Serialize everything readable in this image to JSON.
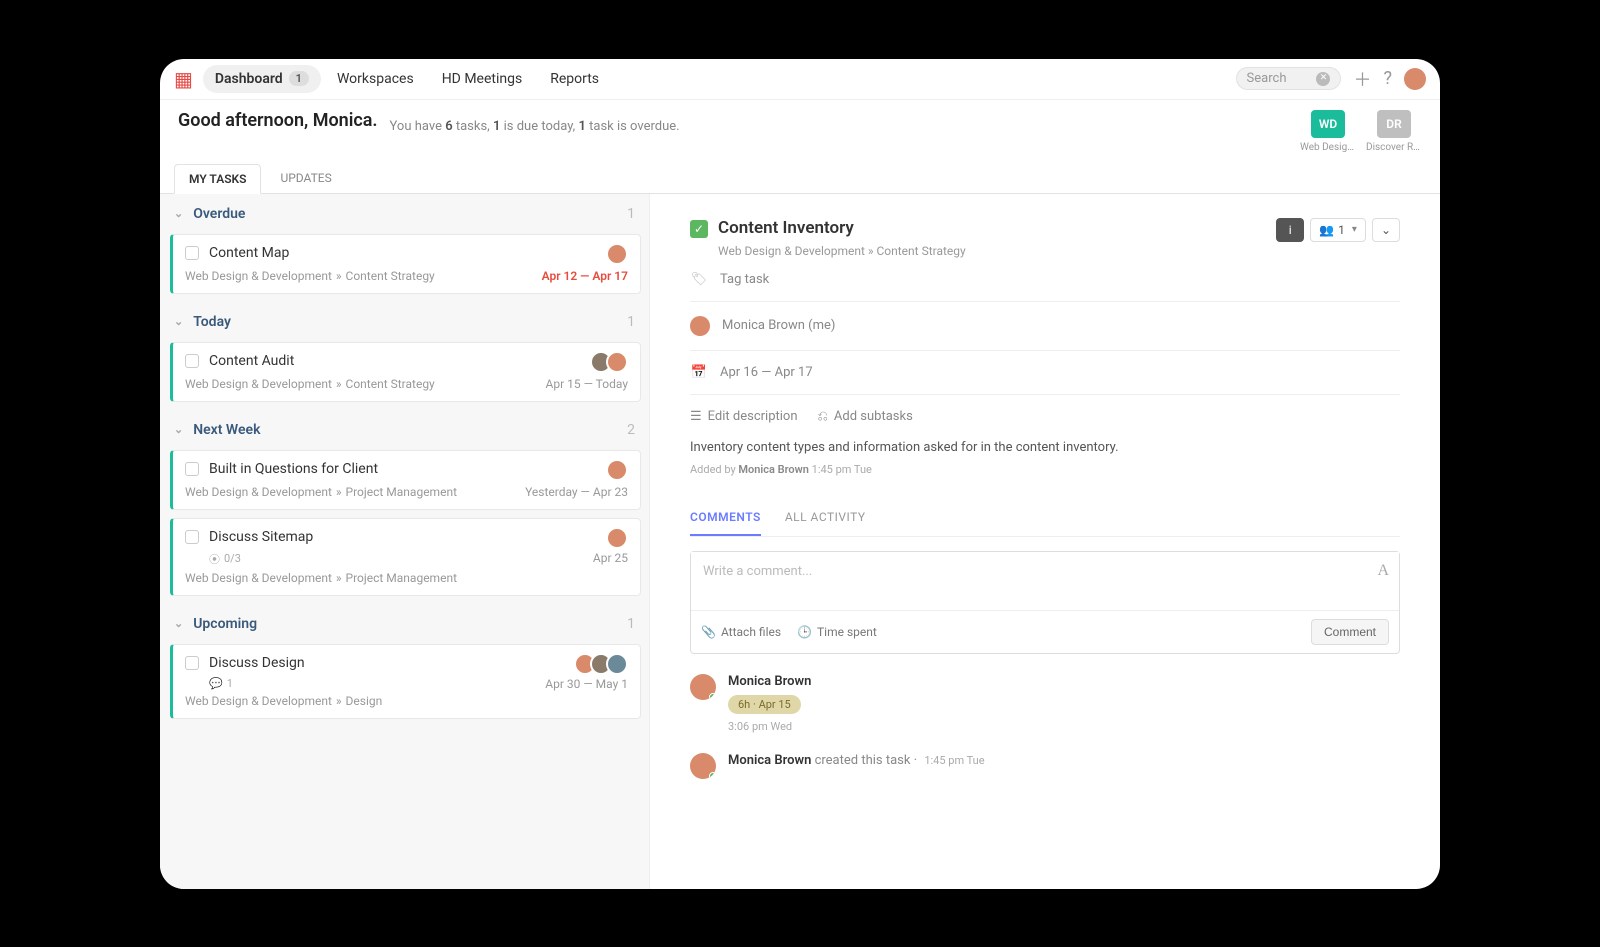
{
  "nav": {
    "items": [
      "Dashboard",
      "Workspaces",
      "HD Meetings",
      "Reports"
    ],
    "dashboard_badge": "1",
    "search_placeholder": "Search"
  },
  "greeting": {
    "title": "Good afternoon, Monica.",
    "sub_prefix": "You have ",
    "tasks_count": "6",
    "sub_mid1": " tasks, ",
    "due_today": "1",
    "sub_mid2": " is due today, ",
    "overdue": "1",
    "sub_suffix": " task is overdue."
  },
  "workspaces": [
    {
      "abbr": "WD",
      "label": "Web Design ...",
      "color": "ws-teal"
    },
    {
      "abbr": "DR",
      "label": "Discover Re...",
      "color": "ws-gray"
    }
  ],
  "subtabs": {
    "my_tasks": "MY TASKS",
    "updates": "UPDATES"
  },
  "groups": [
    {
      "name": "Overdue",
      "count": "1",
      "tasks": [
        {
          "title": "Content Map",
          "path1": "Web Design & Development",
          "path2": "Content Strategy",
          "date": "Apr 12 — Apr 17",
          "overdue": true,
          "avatars": 1
        }
      ]
    },
    {
      "name": "Today",
      "count": "1",
      "tasks": [
        {
          "title": "Content Audit",
          "path1": "Web Design & Development",
          "path2": "Content Strategy",
          "date": "Apr 15 — Today",
          "avatars": 2
        }
      ]
    },
    {
      "name": "Next Week",
      "count": "2",
      "tasks": [
        {
          "title": "Built in Questions for Client",
          "path1": "Web Design & Development",
          "path2": "Project Management",
          "date": "Yesterday — Apr 23",
          "avatars": 1
        },
        {
          "title": "Discuss Sitemap",
          "path1": "Web Design & Development",
          "path2": "Project Management",
          "date": "Apr 25",
          "avatars": 1,
          "subtasks": "0/3"
        }
      ]
    },
    {
      "name": "Upcoming",
      "count": "1",
      "tasks": [
        {
          "title": "Discuss Design",
          "path1": "Web Design & Development",
          "path2": "Design",
          "date": "Apr 30 — May 1",
          "avatars": 3,
          "comments": "1"
        }
      ]
    }
  ],
  "detail": {
    "title": "Content Inventory",
    "path1": "Web Design & Development",
    "path2": "Content Strategy",
    "assignee_count": "1",
    "tag_label": "Tag task",
    "assignee": "Monica Brown (me)",
    "dates": "Apr 16 — Apr 17",
    "edit_desc": "Edit description",
    "add_subtasks": "Add subtasks",
    "description": "Inventory content types and information asked for in the content inventory.",
    "added_by_prefix": "Added by ",
    "added_by_name": "Monica Brown",
    "added_by_time": "1:45 pm Tue",
    "tabs": {
      "comments": "COMMENTS",
      "activity": "ALL ACTIVITY"
    },
    "comment_placeholder": "Write a comment...",
    "attach": "Attach files",
    "time_spent": "Time spent",
    "comment_btn": "Comment",
    "activity": [
      {
        "name": "Monica Brown",
        "chip": "6h · Apr 15",
        "time": "3:06 pm Wed"
      }
    ],
    "created": {
      "name": "Monica Brown",
      "text": " created this task",
      "time": "1:45 pm Tue"
    }
  }
}
